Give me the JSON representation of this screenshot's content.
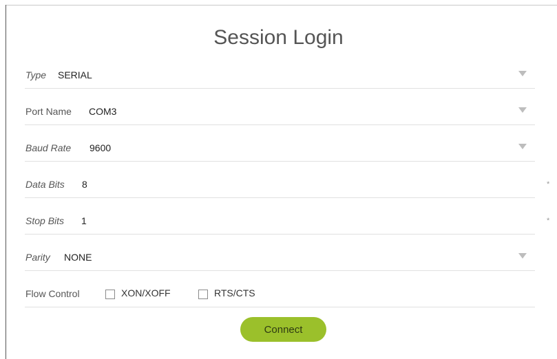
{
  "title": "Session Login",
  "fields": {
    "type": {
      "label": "Type",
      "value": "SERIAL"
    },
    "port_name": {
      "label": "Port Name",
      "value": "COM3"
    },
    "baud_rate": {
      "label": "Baud Rate",
      "value": "9600"
    },
    "data_bits": {
      "label": "Data Bits",
      "value": "8"
    },
    "stop_bits": {
      "label": "Stop Bits",
      "value": "1"
    },
    "parity": {
      "label": "Parity",
      "value": "NONE"
    }
  },
  "flow_control": {
    "label": "Flow Control",
    "options": [
      {
        "label": "XON/XOFF",
        "checked": false
      },
      {
        "label": "RTS/CTS",
        "checked": false
      }
    ]
  },
  "required_marker": "*",
  "connect_label": "Connect",
  "colors": {
    "accent": "#9bc02b",
    "divider": "#e0e0e0",
    "caret": "#bdbdbd"
  },
  "icons": {
    "dropdown": "chevron-down-icon",
    "required": "asterisk-icon"
  }
}
